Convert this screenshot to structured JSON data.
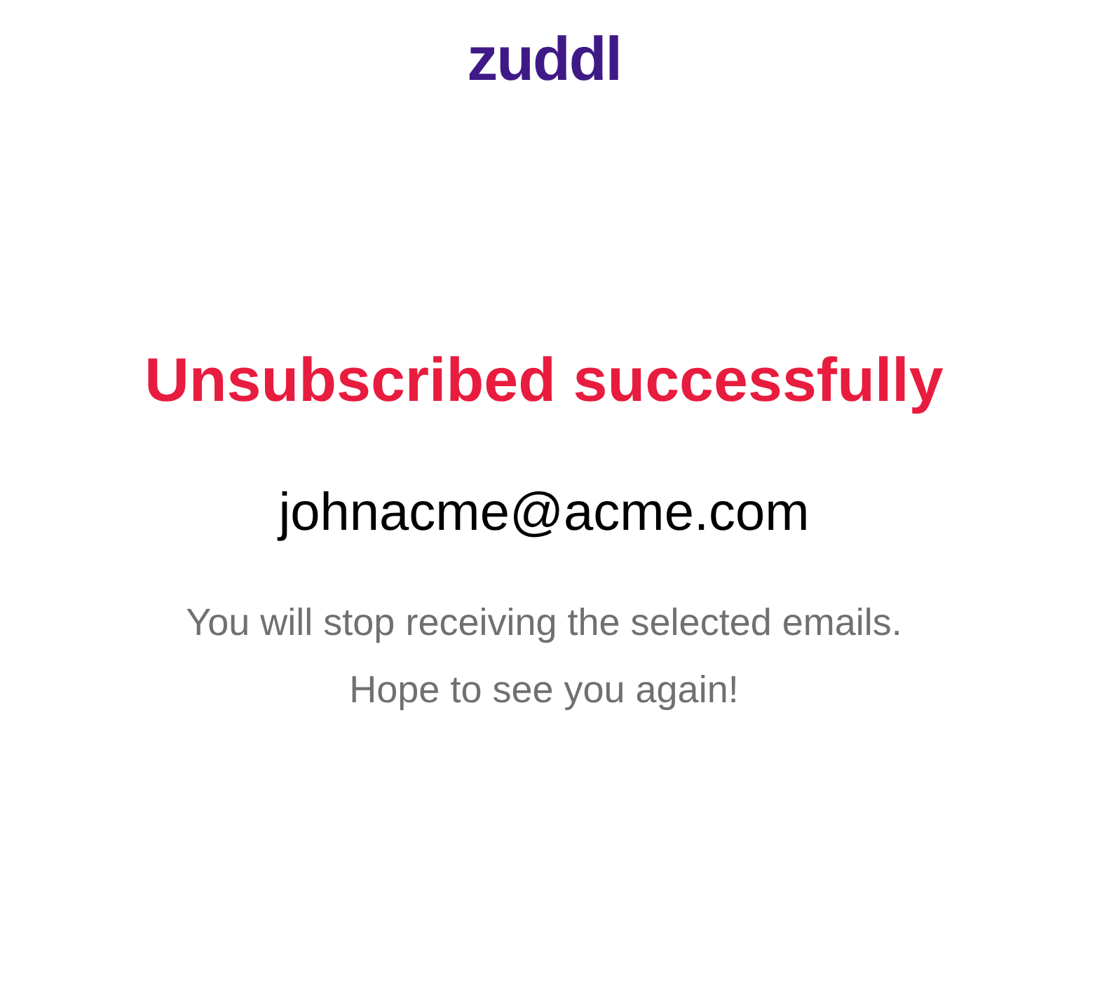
{
  "logo": {
    "text": "zuddl"
  },
  "heading": "Unsubscribed successfully",
  "email": "johnacme@acme.com",
  "message_lines": [
    "You will stop receiving the selected emails.",
    "Hope to see you again!"
  ]
}
